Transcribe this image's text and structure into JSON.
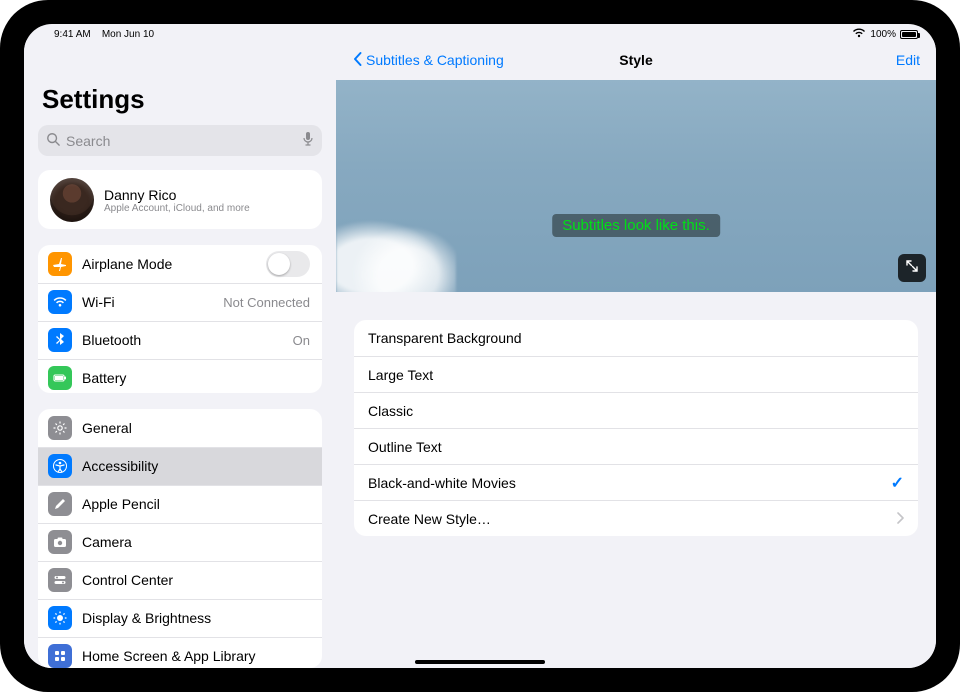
{
  "statusbar": {
    "time": "9:41 AM",
    "date": "Mon Jun 10",
    "battery_pct": "100%"
  },
  "sidebar": {
    "title": "Settings",
    "search_placeholder": "Search",
    "account": {
      "name": "Danny Rico",
      "sub": "Apple Account, iCloud, and more"
    },
    "group_connectivity": {
      "airplane": "Airplane Mode",
      "wifi": "Wi-Fi",
      "wifi_detail": "Not Connected",
      "bluetooth": "Bluetooth",
      "bluetooth_detail": "On",
      "battery": "Battery"
    },
    "group_general": {
      "general": "General",
      "accessibility": "Accessibility",
      "pencil": "Apple Pencil",
      "camera": "Camera",
      "control_center": "Control Center",
      "display": "Display & Brightness",
      "home_screen": "Home Screen & App Library"
    }
  },
  "navbar": {
    "back": "Subtitles & Captioning",
    "title": "Style",
    "edit": "Edit"
  },
  "preview": {
    "sample_text": "Subtitles look like this."
  },
  "styles": {
    "items": [
      {
        "label": "Transparent Background",
        "selected": false
      },
      {
        "label": "Large Text",
        "selected": false
      },
      {
        "label": "Classic",
        "selected": false
      },
      {
        "label": "Outline Text",
        "selected": false
      },
      {
        "label": "Black-and-white Movies",
        "selected": true
      }
    ],
    "create_new": "Create New Style…"
  }
}
